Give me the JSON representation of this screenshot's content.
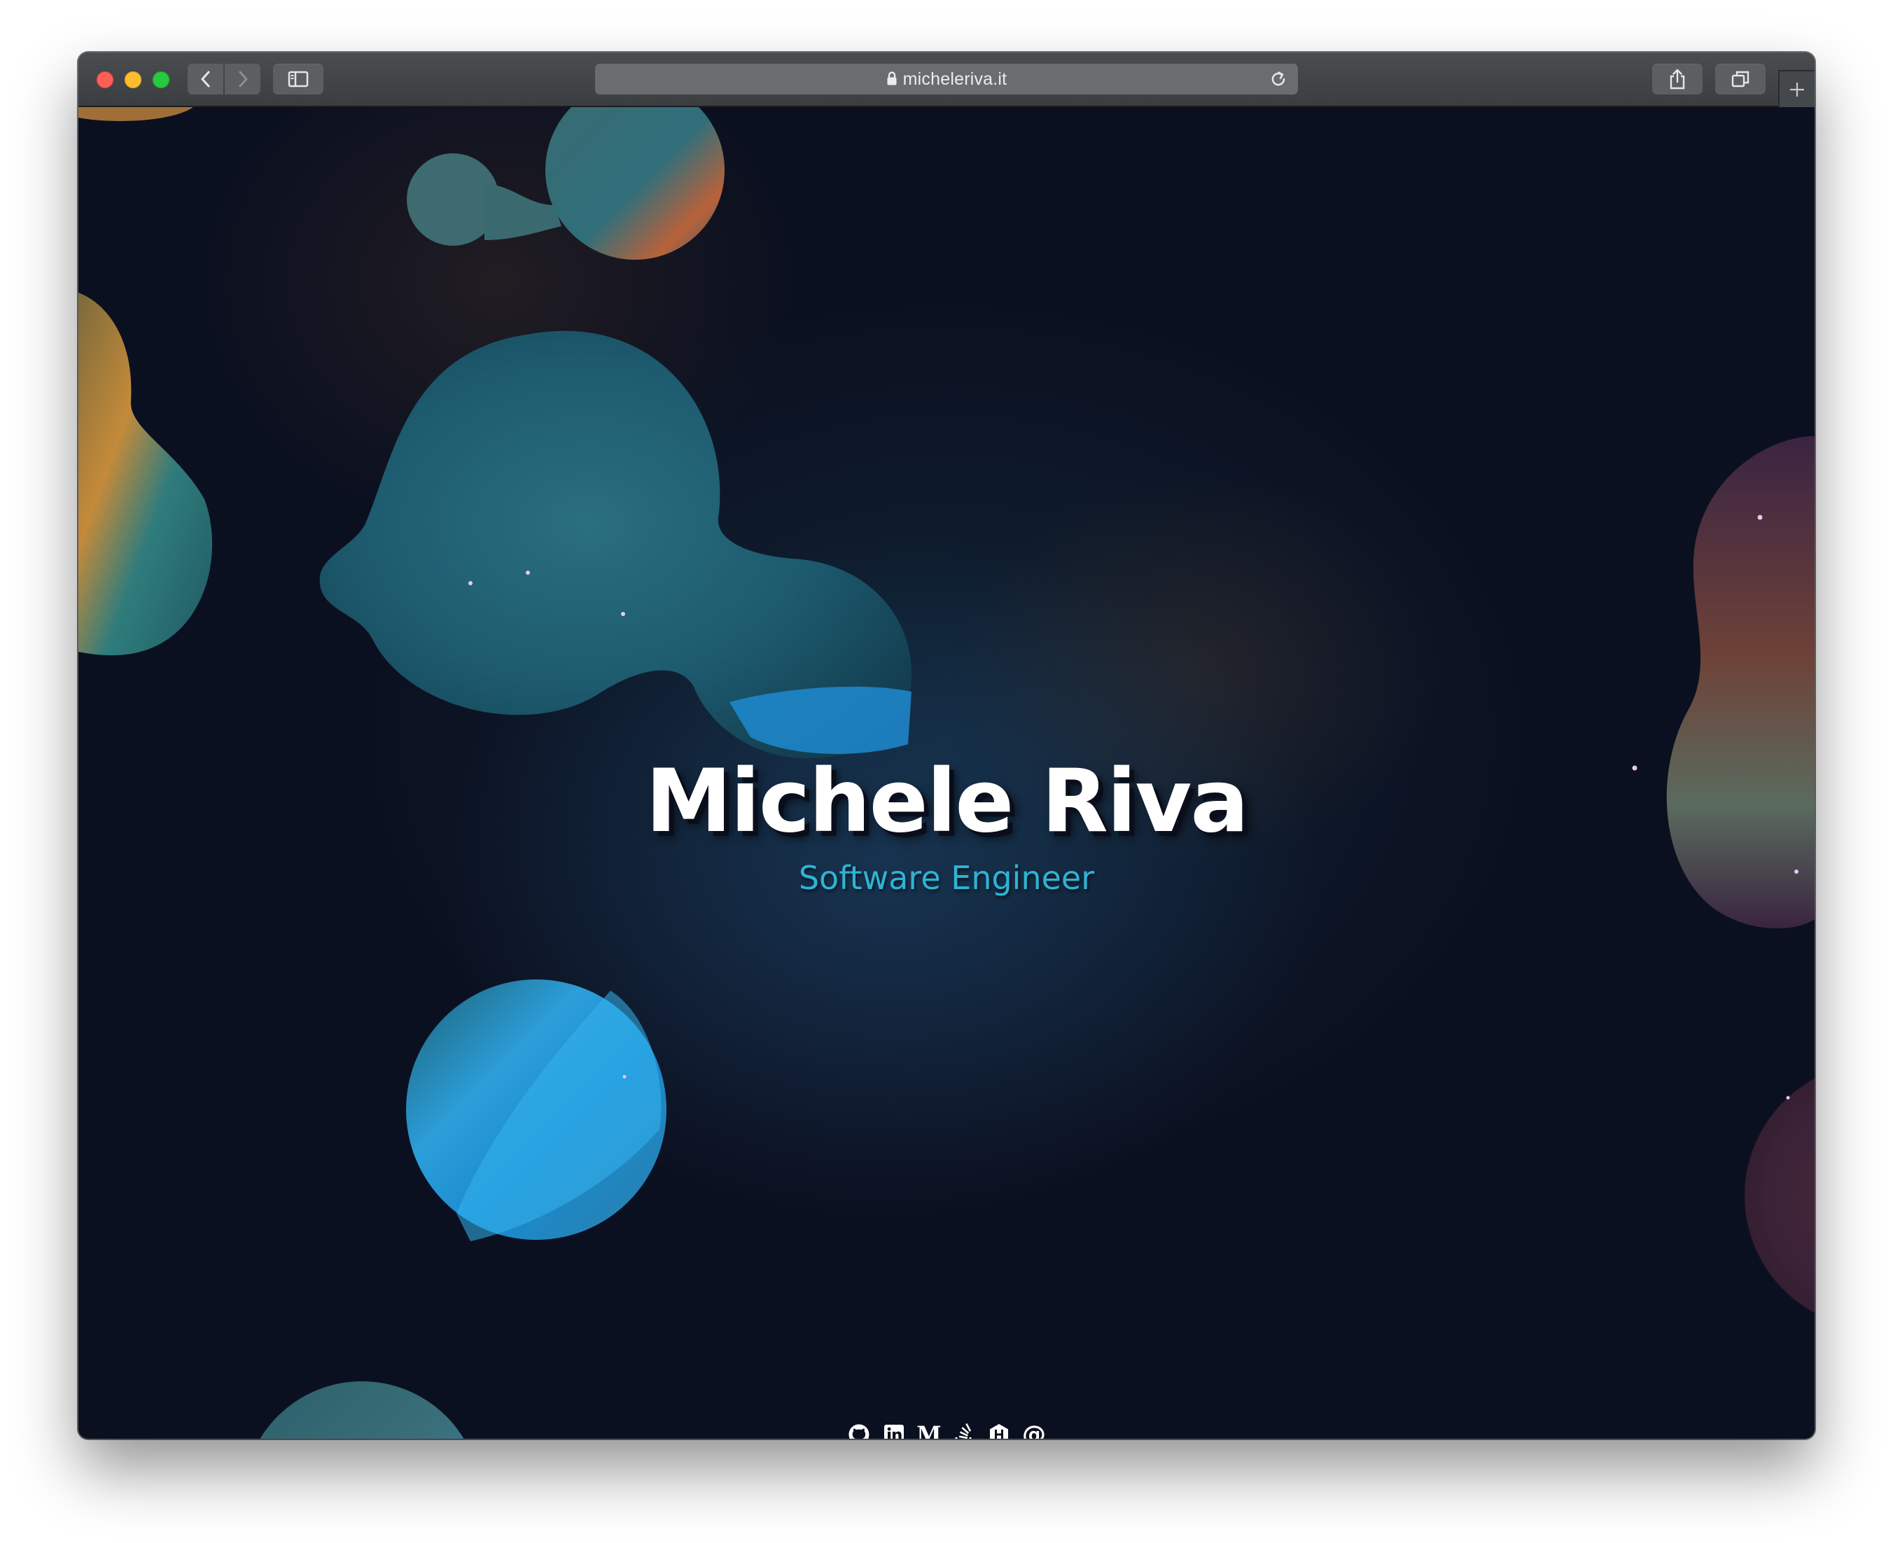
{
  "browser": {
    "url": "micheleriva.it",
    "toolbar": {
      "back_icon": "chevron-left-icon",
      "forward_icon": "chevron-right-icon",
      "sidebar_icon": "sidebar-icon",
      "reload_icon": "reload-icon",
      "share_icon": "share-icon",
      "tabs_icon": "tabs-overview-icon",
      "new_tab_icon": "plus-icon"
    }
  },
  "hero": {
    "name": "Michele Riva",
    "role": "Software Engineer"
  },
  "social": [
    {
      "icon": "github-icon"
    },
    {
      "icon": "linkedin-icon"
    },
    {
      "icon": "medium-icon",
      "label": "M"
    },
    {
      "icon": "stackoverflow-icon"
    },
    {
      "icon": "hashnode-icon"
    },
    {
      "icon": "email-icon",
      "label": "@"
    }
  ],
  "colors": {
    "background": "#0a0d1a",
    "title": "#ffffff",
    "subtitle": "#2fb3d3",
    "toolbar": "#3b3e41",
    "address_bar": "#6a6d70"
  }
}
